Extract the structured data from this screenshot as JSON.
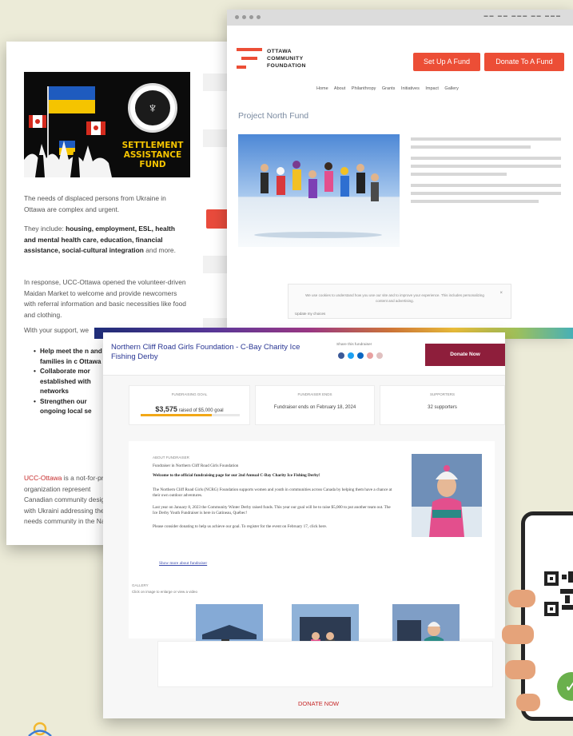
{
  "left_card": {
    "banner_title": "SETTLEMENT ASSISTANCE FUND",
    "p1": "The needs of displaced persons from Ukraine in Ottawa are complex and urgent.",
    "p2_lead": "They include: ",
    "p2_bold": "housing, employment, ESL, health and mental health care, education, financial assistance, social-cultural integration",
    "p2_tail": " and more.",
    "p3": "In response, UCC-Ottawa opened the volunteer-driven Maidan Market to welcome and provide newcomers with referral information and basic necessities like food and clothing.",
    "p4": "With your support, we",
    "bullets": [
      "Help meet the n and families in c Ottawa",
      "Collaborate mor established with networks",
      "Strengthen our ongoing local se"
    ],
    "p5_link": "UCC-Ottawa",
    "p5": " is a not-for-profit organization represent Canadian community designate with Ukraini addressing the needs community in the Nati"
  },
  "ocf_card": {
    "logo_text": [
      "OTTAWA",
      "COMMUNITY",
      "FOUNDATION"
    ],
    "setup_fund_label": "Set Up A Fund",
    "donate_fund_label": "Donate To A Fund",
    "nav": "Home   About   Philanthropy   Grants   Initiatives   Impact   Gallery",
    "page_title": "Project North Fund",
    "notice_text": "We use cookies to understand how you use our site and to improve your experience. This includes personalizing content and advertising.",
    "notice_link": "Update my choices",
    "notice_close": "×"
  },
  "ncg_card": {
    "title": "Northern Cliff Road Girls Foundation - C-Bay Charity Ice Fishing Derby",
    "share_label": "Share this fundraiser",
    "donate_label": "Donate Now",
    "stats": {
      "raised_label": "FUNDRAISING GOAL",
      "raised_amount": "$3,575",
      "raised_of": " raised of $5,000 goal",
      "raised_progress": 0.72,
      "end_label": "FUNDRAISER ENDS",
      "end_value": "Fundraiser ends on February 18, 2024",
      "supporters_label": "SUPPORTERS",
      "supporters_value": "32 supporters"
    },
    "story_label": "ABOUT FUNDRAISER",
    "story_hosted": "Fundraiser in Northern Cliff Road Girls Foundation",
    "story_welcome": "Welcome to the official fundraising page for our 2nd Annual C-Bay Charity Ice Fishing Derby!",
    "story_1": "The Northern Cliff Road Girls (NCRG) Foundation supports women and youth in communities across Canada by helping them have a chance at their own outdoor adventures.",
    "story_2": "Last year on January 8, 2023 the Community Winter Derby raised funds. This year our goal will be to raise $5,000 to put another team out. The Ice Derby Youth Fundraiser is here in Gatineau, Québec!",
    "story_3": "Please consider donating to help us achieve our goal. To register for the event on February 17, click here.",
    "read_more": "Show more about fundraiser",
    "gallery_label": "GALLERY",
    "gallery_sub": "Click on image to enlarge or view a video",
    "footer_donate": "DONATE NOW"
  },
  "colors": {
    "ocf_red": "#ec4e36",
    "ncg_maroon": "#8e1e3b",
    "ukraine_blue": "#1e5bbf",
    "ukraine_yellow": "#f5c400",
    "progress_orange": "#f2a817",
    "confirm_green": "#6ab04c"
  },
  "icons": [
    "ucc-seal-icon",
    "ocf-logo-icon",
    "facebook-icon",
    "twitter-icon",
    "linkedin-icon",
    "email-icon",
    "link-icon",
    "qr-code-icon",
    "check-icon"
  ]
}
